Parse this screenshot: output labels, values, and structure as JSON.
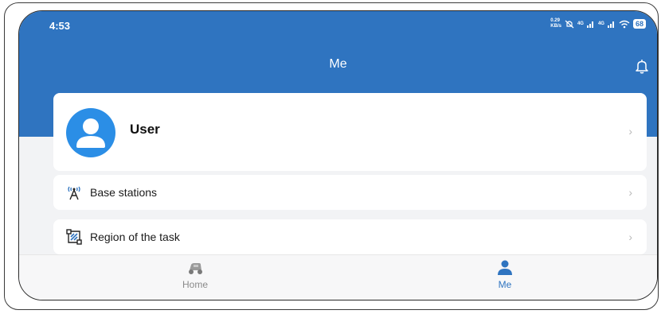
{
  "status_bar": {
    "time": "4:53",
    "net_speed_value": "0.29",
    "net_speed_unit": "KB/s",
    "signal_1": "4G",
    "signal_2": "4G",
    "battery": "68"
  },
  "header": {
    "title": "Me",
    "bell_icon": "bell-icon"
  },
  "profile": {
    "name": "User",
    "avatar_icon": "user-avatar-icon"
  },
  "menu": {
    "items": [
      {
        "label": "Base stations",
        "icon": "antenna-icon"
      },
      {
        "label": "Region of the task",
        "icon": "region-grid-icon"
      }
    ]
  },
  "tabbar": {
    "tabs": [
      {
        "label": "Home",
        "icon": "mower-icon",
        "active": false
      },
      {
        "label": "Me",
        "icon": "person-icon",
        "active": true
      }
    ]
  },
  "colors": {
    "primary": "#2f74c0",
    "avatar_bg": "#2b8ee6",
    "background": "#f2f3f5",
    "inactive_tab": "#8a8a8a"
  }
}
